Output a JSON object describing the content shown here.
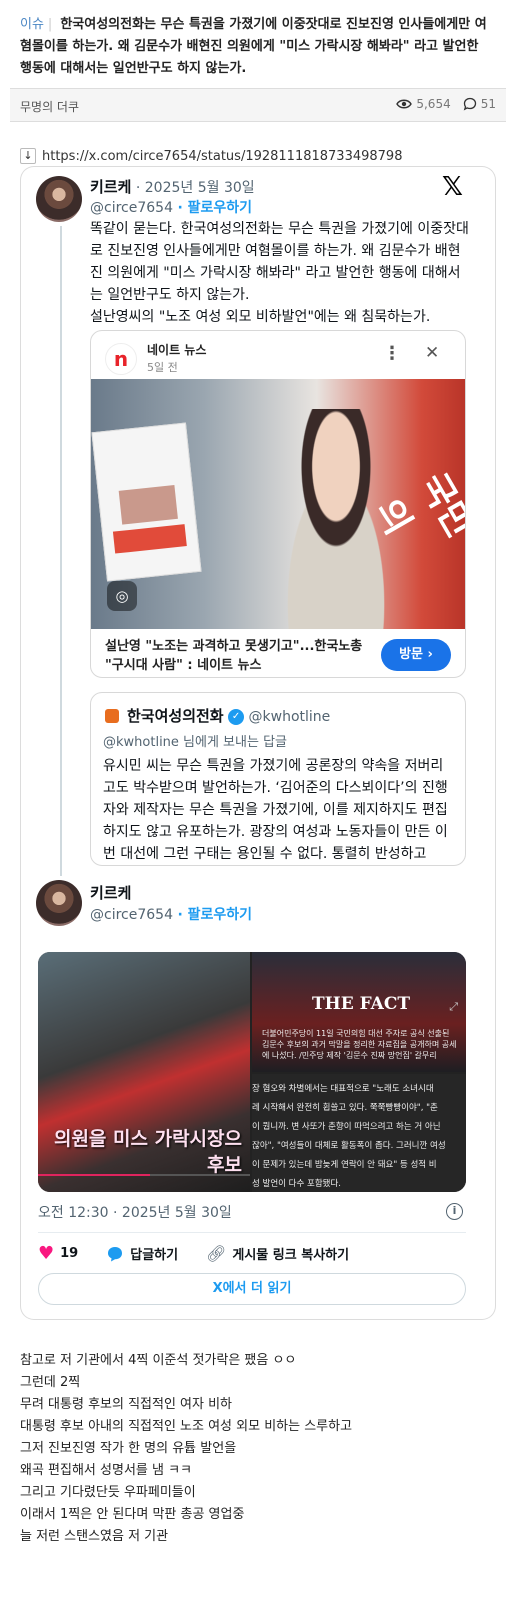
{
  "post": {
    "category": "이슈",
    "title": "한국여성의전화는 무슨 특권을 가졌기에 이중잣대로 진보진영 인사들에게만 여혐몰이를 하는가. 왜 김문수가 배현진 의원에게 \"미스 가락시장 해봐라\" 라고 발언한 행동에 대해서는 일언반구도 하지 않는가.",
    "author": "무명의 더쿠",
    "views": "5,654",
    "comments": "51",
    "link": "https://x.com/circe7654/status/1928111818733498798"
  },
  "tweet": {
    "display_name": "키르케",
    "date": "· 2025년 5월 30일",
    "handle": "@circe7654",
    "follow": "· 팔로우하기",
    "x_logo": "𝕏",
    "text": "똑같이 묻는다. 한국여성의전화는 무슨 특권을 가졌기에 이중잣대로 진보진영 인사들에게만 여혐몰이를 하는가. 왜 김문수가 배현진 의원에게 \"미스 가락시장 해봐라\" 라고 발언한 행동에 대해서는 일언반구도 하지 않는가.\n설난영씨의 \"노조 여성 외모 비하발언\"에는 왜 침묵하는가.",
    "timestamp": "오전 12:30 · 2025년 5월 30일",
    "likes": "19",
    "reply_label": "답글하기",
    "copy_label": "게시물 링크 복사하기",
    "read_more": "X에서 더 읽기"
  },
  "news": {
    "source": "네이트 뉴스",
    "time": "5일 전",
    "logo_letter": "n",
    "more": "⋮",
    "close": "✕",
    "party_text": "국민의",
    "title": "설난영 \"노조는 과격하고 못생기고\"...한국노총 \"구시대 사람\" : 네이트 뉴스",
    "visit": "방문 ›"
  },
  "quote": {
    "name": "한국여성의전화",
    "handle": "@kwhotline",
    "reply_to": "@kwhotline 님에게 보내는 답글",
    "text": "유시민 씨는 무슨 특권을 가졌기에 공론장의 약속을 저버리고도 박수받으며 발언하는가. ‘김어준의 다스뵈이다’의 진행자와 제작자는 무슨 특권을 가졌기에, 이를 제지하지도 편집하지도 않고 유포하는가. 광장의 여성과 노동자들이 만든 이번 대선에 그런 구태는 용인될 수 없다. 통렬히 반성하고"
  },
  "reply_tweet": {
    "display_name": "키르케",
    "handle": "@circe7654",
    "follow": "· 팔로우하기"
  },
  "media": {
    "caption1": "의원을 미스 가락시장으\n후보",
    "fact_title": "THE FACT",
    "fact_small": "더불어민주당이 11일 국민의힘 대선 주자로 공식 선출된 김문수 후보의 과거 막말을 정리한 자료집을 공개하며 공세에 나섰다. /민주당 제작 '김문수 진짜 망언집' 갈무리",
    "fact_lines": [
      "장 혐오와 차별에서는 대표적으로 \"노래도 소녀시대",
      "레 시작해서 완전히 휩쓸고 있다. 쭉쭉빵빵이야\", \"춘",
      "이 뭡니까. 변 사또가 춘향이 따먹으려고 하는 거 아닌",
      "잖아\", \"여성들이 대체로 활동폭이 좁다. 그러니깐 여성",
      "이 문제가 있는데 밤늦게 연락이 안 돼요\" 등 성적 비",
      "성 발언이 다수 포함됐다."
    ],
    "video_progress": 0.53
  },
  "body_lines": [
    "참고로 저 기관에서 4찍 이준석 젓가락은 팼음 ㅇㅇ",
    "그런데 2찍",
    "무려 대통령 후보의 직접적인 여자 비하",
    "대통령 후보 아내의 직접적인 노조 여성 외모 비하는 스루하고",
    "그저 진보진영 작가 한 명의 유튭 발언을",
    "왜곡 편집해서 성명서를 냄 ㅋㅋ",
    "그리고 기다렸단듯 우파페미들이",
    "이래서 1찍은 안 된다며 막판 총공 영업중",
    "늘 저런 스탠스였음 저 기관"
  ]
}
